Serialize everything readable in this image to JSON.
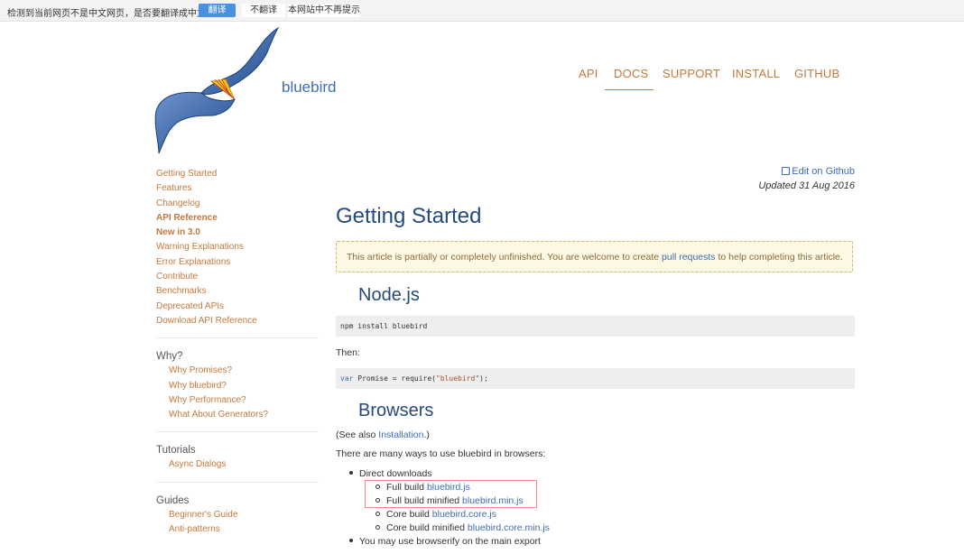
{
  "translate_bar": {
    "message": "检测到当前网页不是中文网页，是否要翻译成中文？",
    "translate": "翻译",
    "no_translate": "不翻译",
    "never": "本网站中不再提示"
  },
  "header": {
    "brand": "bluebird",
    "nav": [
      "API",
      "DOCS",
      "SUPPORT",
      "INSTALL",
      "GITHUB"
    ],
    "active_nav": "DOCS"
  },
  "sidebar": {
    "items": [
      "Getting Started",
      "Features",
      "Changelog",
      "API Reference",
      "New in 3.0",
      "Warning Explanations",
      "Error Explanations",
      "Contribute",
      "Benchmarks",
      "Deprecated APIs",
      "Download API Reference"
    ],
    "why": {
      "title": "Why?",
      "items": [
        "Why Promises?",
        "Why bluebird?",
        "Why Performance?",
        "What About Generators?"
      ]
    },
    "tutorials": {
      "title": "Tutorials",
      "items": [
        "Async Dialogs"
      ]
    },
    "guides": {
      "title": "Guides",
      "items": [
        "Beginner's Guide",
        "Anti-patterns"
      ]
    }
  },
  "main": {
    "edit_link": "Edit on Github",
    "updated": "Updated 31 Aug 2016",
    "title": "Getting Started",
    "note": {
      "pre": "This article is partially or completely unfinished. You are welcome to create ",
      "link": "pull requests",
      "post": " to help completing this article."
    },
    "nodejs": {
      "heading": "Node.js",
      "install_cmd": "npm install bluebird",
      "then": "Then:",
      "code_kw": "var",
      "code_mid": " Promise = require(",
      "code_str": "\"bluebird\"",
      "code_end": ");"
    },
    "browsers": {
      "heading": "Browsers",
      "see_also_pre": "(See also ",
      "see_also_link": "Installation",
      "see_also_post": ".)",
      "intro": "There are many ways to use bluebird in browsers:",
      "direct_downloads": "Direct downloads",
      "downloads": [
        {
          "label": "Full build ",
          "link": "bluebird.js"
        },
        {
          "label": "Full build minified ",
          "link": "bluebird.min.js"
        },
        {
          "label": "Core build ",
          "link": "bluebird.core.js"
        },
        {
          "label": "Core build minified ",
          "link": "bluebird.core.min.js"
        }
      ],
      "browserify": "You may use browserify on the main export"
    }
  },
  "colors": {
    "link_orange": "#c4783c",
    "link_blue": "#3d6db4",
    "heading_blue": "#254a7e",
    "note_bg": "#fcf8e3",
    "highlight_red": "#f28b8b"
  }
}
